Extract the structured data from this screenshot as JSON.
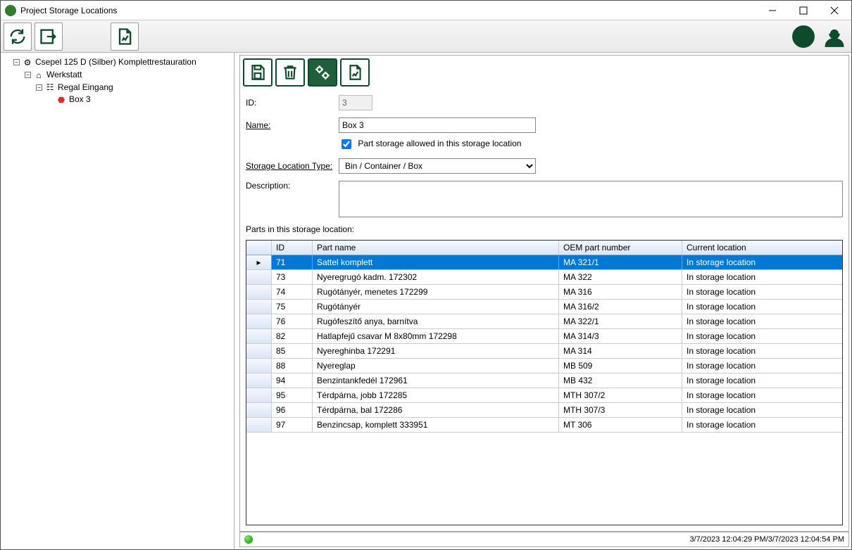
{
  "window": {
    "title": "Project Storage Locations"
  },
  "tree": {
    "root": "Csepel 125 D (Silber) Komplettrestauration",
    "child1": "Werkstatt",
    "child2": "Regal Eingang",
    "leaf": "Box 3"
  },
  "labels": {
    "id": "ID:",
    "name": "Name:",
    "checkbox": "Part storage allowed in this storage location",
    "type": "Storage Location Type:",
    "desc": "Description:",
    "parts_header": "Parts in this storage location:"
  },
  "form": {
    "id_value": "3",
    "name_value": "Box 3",
    "part_allowed": true,
    "type_value": "Bin / Container / Box",
    "description": ""
  },
  "columns": {
    "id": "ID",
    "name": "Part name",
    "oem": "OEM part number",
    "loc": "Current location"
  },
  "rows": [
    {
      "id": "71",
      "name": "Sattel komplett",
      "oem": "MA 321/1",
      "loc": "In storage location",
      "selected": true
    },
    {
      "id": "73",
      "name": "Nyeregrugó kadm. 172302",
      "oem": "MA 322",
      "loc": "In storage location"
    },
    {
      "id": "74",
      "name": "Rugótányér, menetes 172299",
      "oem": "MA 316",
      "loc": "In storage location"
    },
    {
      "id": "75",
      "name": "Rugótányér",
      "oem": "MA 316/2",
      "loc": "In storage location"
    },
    {
      "id": "76",
      "name": "Rugófeszítő anya, barnítva",
      "oem": "MA 322/1",
      "loc": "In storage location"
    },
    {
      "id": "82",
      "name": "Hatlapfejű csavar M 8x80mm 172298",
      "oem": "MA 314/3",
      "loc": "In storage location"
    },
    {
      "id": "85",
      "name": "Nyereghinba 172291",
      "oem": "MA 314",
      "loc": "In storage location"
    },
    {
      "id": "88",
      "name": "Nyereglap",
      "oem": "MB 509",
      "loc": "In storage location"
    },
    {
      "id": "94",
      "name": "Benzintankfedél 172961",
      "oem": "MB 432",
      "loc": "In storage location"
    },
    {
      "id": "95",
      "name": "Térdpárna, jobb 172285",
      "oem": "MTH 307/2",
      "loc": "In storage location"
    },
    {
      "id": "96",
      "name": "Térdpárna, bal 172286",
      "oem": "MTH 307/3",
      "loc": "In storage location"
    },
    {
      "id": "97",
      "name": "Benzincsap, komplett 333951",
      "oem": "MT 306",
      "loc": "In storage location"
    }
  ],
  "status": {
    "left": "3/7/2023 12:04:29 PM",
    "right": "3/7/2023 12:04:54 PM",
    "sep": " / "
  }
}
